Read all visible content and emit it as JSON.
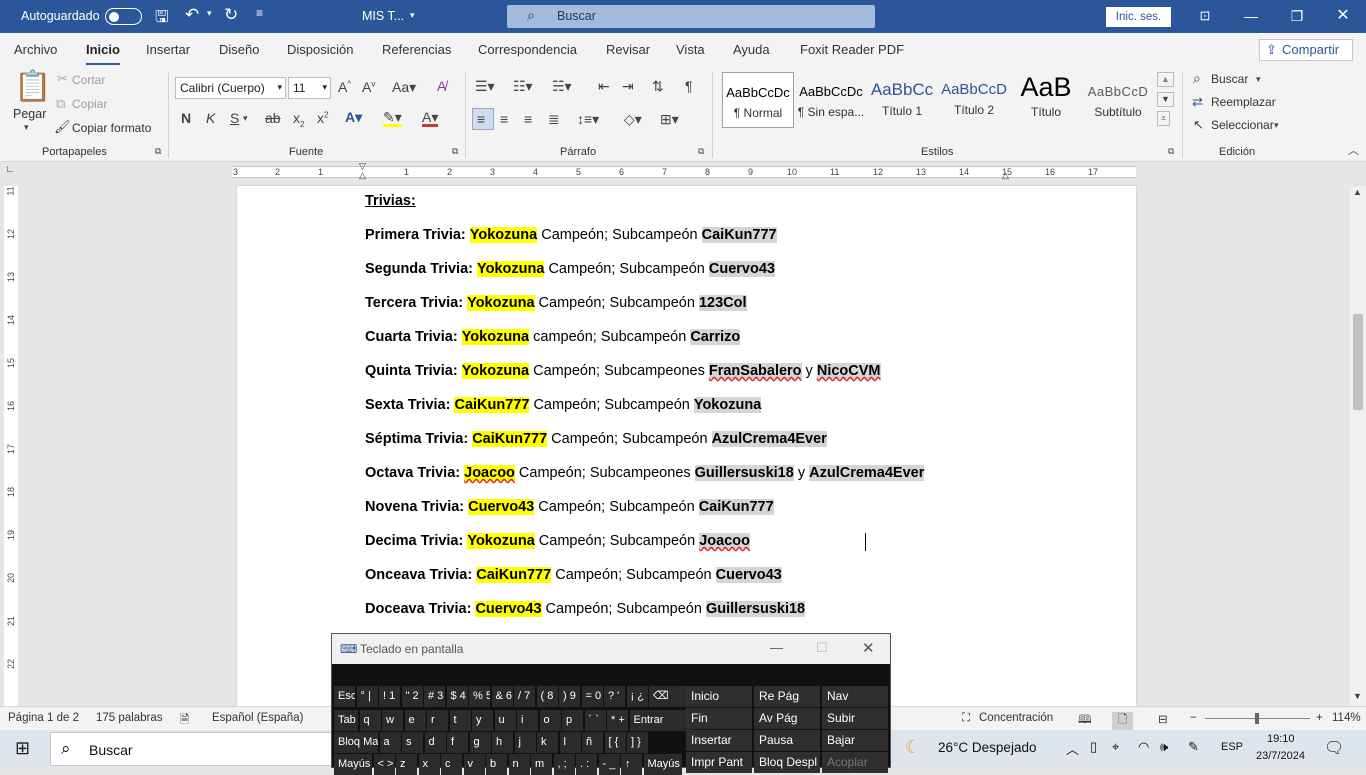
{
  "titlebar": {
    "autosave_label": "Autoguardado",
    "doc_title": "MIS T...",
    "search_placeholder": "Buscar",
    "signin": "Inic. ses."
  },
  "tabs": [
    "Archivo",
    "Inicio",
    "Insertar",
    "Diseño",
    "Disposición",
    "Referencias",
    "Correspondencia",
    "Revisar",
    "Vista",
    "Ayuda",
    "Foxit Reader PDF"
  ],
  "share_label": "Compartir",
  "clipboard": {
    "paste": "Pegar",
    "cut": "Cortar",
    "copy": "Copiar",
    "format_painter": "Copiar formato",
    "group": "Portapapeles"
  },
  "font": {
    "family": "Calibri (Cuerpo)",
    "size": "11",
    "group": "Fuente"
  },
  "paragraph_group": "Párrafo",
  "styles": {
    "group": "Estilos",
    "items": [
      {
        "preview": "AaBbCcDc",
        "name": "¶ Normal"
      },
      {
        "preview": "AaBbCcDc",
        "name": "¶ Sin espa..."
      },
      {
        "preview": "AaBbCc",
        "name": "Título 1"
      },
      {
        "preview": "AaBbCcD",
        "name": "Título 2"
      },
      {
        "preview": "AaB",
        "name": "Título"
      },
      {
        "preview": "AaBbCcD",
        "name": "Subtítulo"
      }
    ]
  },
  "editing": {
    "find": "Buscar",
    "replace": "Reemplazar",
    "select": "Seleccionar",
    "group": "Edición"
  },
  "ruler_numbers": [
    "3",
    "2",
    "1",
    "1",
    "2",
    "3",
    "4",
    "5",
    "6",
    "7",
    "8",
    "9",
    "10",
    "11",
    "12",
    "13",
    "14",
    "15",
    "16",
    "17"
  ],
  "vruler_numbers": [
    "11",
    "12",
    "13",
    "14",
    "15",
    "16",
    "17",
    "18",
    "19",
    "20",
    "21",
    "22"
  ],
  "document": {
    "heading": "Trivias:",
    "lines": [
      {
        "label": "Primera Trivia:",
        "winner": "Yokozuna",
        "mid": " Campeón; Subcampeón ",
        "runner": "CaiKun777"
      },
      {
        "label": "Segunda Trivia:",
        "winner": "Yokozuna",
        "mid": " Campeón; Subcampeón ",
        "runner": "Cuervo43"
      },
      {
        "label": "Tercera Trivia:",
        "winner": "Yokozuna",
        "mid": " Campeón; Subcampeón ",
        "runner": "123Col"
      },
      {
        "label": "Cuarta Trivia:",
        "winner": "Yokozuna",
        "mid": " campeón; Subcampeón ",
        "runner": "Carrizo"
      },
      {
        "label": "Quinta Trivia:",
        "winner": "Yokozuna",
        "mid": " Campeón; Subcampeones ",
        "runner": "FranSabalero",
        "and": " y ",
        "runner2": "NicoCVM"
      },
      {
        "label": "Sexta Trivia:",
        "winner": "CaiKun777",
        "mid": " Campeón; Subcampeón ",
        "runner": "Yokozuna"
      },
      {
        "label": "Séptima Trivia:",
        "winner": "CaiKun777",
        "mid": " Campeón; Subcampeón ",
        "runner": "AzulCrema4Ever"
      },
      {
        "label": "Octava Trivia:",
        "winner": "Joacoo",
        "mid": " Campeón; Subcampeones ",
        "runner": "Guillersuski18",
        "and": " y ",
        "runner2": "AzulCrema4Ever"
      },
      {
        "label": "Novena Trivia:",
        "winner": "Cuervo43",
        "mid": " Campeón; Subcampeón ",
        "runner": "CaiKun777"
      },
      {
        "label": "Decima Trivia:",
        "winner": "Yokozuna",
        "mid": " Campeón; Subcampeón ",
        "runner": "Joacoo"
      },
      {
        "label": "Onceava Trivia:",
        "winner": "CaiKun777",
        "mid": " Campeón; Subcampeón ",
        "runner": "Cuervo43"
      },
      {
        "label": "Doceava Trivia:",
        "winner": "Cuervo43",
        "mid": " Campeón; Subcampeón ",
        "runner": "Guillersuski18"
      }
    ]
  },
  "status": {
    "page": "Página 1 de 2",
    "words": "175 palabras",
    "language": "Español (España)",
    "focus": "Concentración",
    "zoom": "114%"
  },
  "osk": {
    "title": "Teclado en pantalla",
    "row1": [
      "Esc",
      "° |",
      "! 1",
      "\" 2",
      "# 3",
      "$ 4",
      "% 5",
      "& 6",
      "/ 7",
      "( 8",
      ") 9",
      "= 0",
      "? '",
      "¡ ¿",
      "⌫"
    ],
    "row2": [
      "Tab",
      "q",
      "w",
      "e",
      "r",
      "t",
      "y",
      "u",
      "i",
      "o",
      "p",
      "´ `",
      "* +",
      "Entrar"
    ],
    "row3": [
      "Bloq Mayús",
      "a",
      "s",
      "d",
      "f",
      "g",
      "h",
      "j",
      "k",
      "l",
      "ñ",
      "[ {",
      "] }"
    ],
    "row4": [
      "Mayús",
      "< >",
      "z",
      "x",
      "c",
      "v",
      "b",
      "n",
      "m",
      ", ;",
      ". :",
      "- _",
      "↑",
      "Mayús"
    ],
    "nav": [
      [
        "Inicio",
        "Re Pág",
        "Nav"
      ],
      [
        "Fin",
        "Av Pág",
        "Subir"
      ],
      [
        "Insertar",
        "Pausa",
        "Bajar"
      ],
      [
        "Impr Pant",
        "Bloq Despl",
        "Acoplar"
      ]
    ]
  },
  "taskbar": {
    "search": "Buscar",
    "weather": "26°C  Despejado",
    "lang": "ESP",
    "time": "19:10",
    "date": "23/7/2024"
  }
}
